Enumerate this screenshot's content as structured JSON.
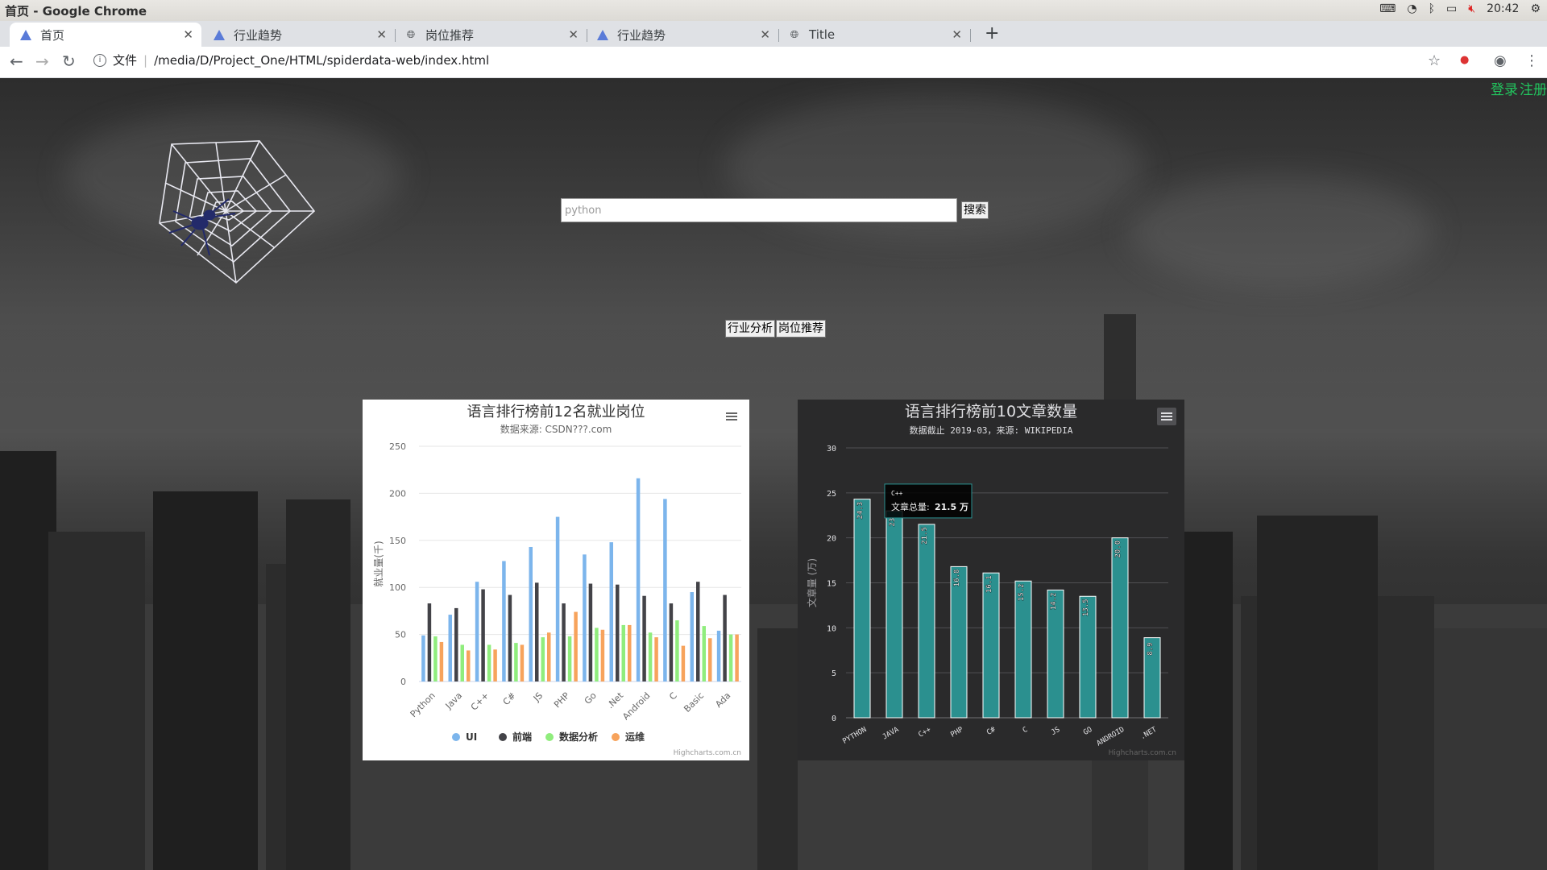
{
  "os": {
    "window_title": "首页 - Google Chrome",
    "clock": "20:42"
  },
  "browser": {
    "tabs": [
      {
        "label": "首页",
        "icon": "highcharts-favicon",
        "active": true
      },
      {
        "label": "行业趋势",
        "icon": "highcharts-favicon",
        "active": false
      },
      {
        "label": "岗位推荐",
        "icon": "globe-icon",
        "active": false
      },
      {
        "label": "行业趋势",
        "icon": "highcharts-favicon",
        "active": false
      },
      {
        "label": "Title",
        "icon": "globe-icon",
        "active": false
      }
    ],
    "address": {
      "scheme_label": "文件",
      "url": "/media/D/Project_One/HTML/spiderdata-web/index.html"
    }
  },
  "page": {
    "auth": {
      "login": "登录",
      "register": "注册"
    },
    "search": {
      "placeholder": "python",
      "button": "搜索"
    },
    "nav": {
      "industry": "行业分析",
      "jobs": "岗位推荐"
    }
  },
  "chart_data": [
    {
      "type": "bar",
      "title": "语言排行榜前12名就业岗位",
      "subtitle": "数据来源: CSDN???.com",
      "ylabel": "就业量(千)",
      "ylim": [
        0,
        250
      ],
      "yticks": [
        0,
        50,
        100,
        150,
        200,
        250
      ],
      "categories": [
        "Python",
        "Java",
        "C++",
        "C#",
        "JS",
        "PHP",
        "Go",
        ".Net",
        "Android",
        "C",
        "Basic",
        "Ada"
      ],
      "series": [
        {
          "name": "UI",
          "color": "#7cb5ec",
          "values": [
            49,
            71,
            106,
            128,
            143,
            175,
            135,
            148,
            216,
            194,
            95,
            54
          ]
        },
        {
          "name": "前端",
          "color": "#434348",
          "values": [
            83,
            78,
            98,
            92,
            105,
            83,
            104,
            103,
            91,
            83,
            106,
            92
          ]
        },
        {
          "name": "数据分析",
          "color": "#90ed7d",
          "values": [
            48,
            39,
            39,
            41,
            47,
            48,
            57,
            60,
            52,
            65,
            59,
            50
          ]
        },
        {
          "name": "运维",
          "color": "#f7a35c",
          "values": [
            42,
            33,
            34,
            39,
            52,
            74,
            55,
            60,
            47,
            38,
            46,
            50
          ]
        }
      ],
      "legend": "bottom-center",
      "credits": "Highcharts.com.cn"
    },
    {
      "type": "bar",
      "title": "语言排行榜前10文章数量",
      "subtitle": "数据截止 2019-03，来源: WIKIPEDIA",
      "ylabel": "文章量 (万)",
      "ylim": [
        0,
        30
      ],
      "yticks": [
        0,
        5,
        10,
        15,
        20,
        25,
        30
      ],
      "categories": [
        "PYTHON",
        "JAVA",
        "C++",
        "PHP",
        "C#",
        "C",
        "JS",
        "GO",
        "ANDROID",
        ".NET"
      ],
      "values": [
        24.3,
        23.0,
        21.5,
        16.8,
        16.1,
        15.2,
        14.2,
        13.5,
        20.0,
        8.9
      ],
      "data_labels": [
        "24.3",
        "23",
        "21.5",
        "16.8",
        "16.1",
        "15.2",
        "14.2",
        "13.5",
        "20.0",
        "8.9"
      ],
      "color": "#2b908f",
      "tooltip": {
        "category": "C++",
        "label": "文章总量:",
        "value": "21.5 万"
      },
      "credits": "Highcharts.com.cn"
    }
  ]
}
